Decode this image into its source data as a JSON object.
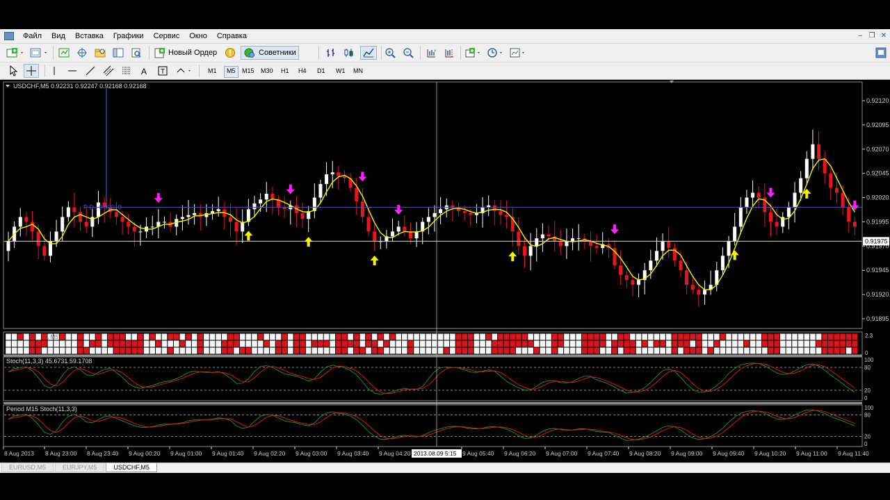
{
  "menu": [
    "Файл",
    "Вид",
    "Вставка",
    "Графики",
    "Сервис",
    "Окно",
    "Справка"
  ],
  "toolbar": {
    "new_order": "Новый Ордер",
    "advisors": "Советники"
  },
  "timeframes": [
    "M1",
    "M5",
    "M15",
    "M30",
    "H1",
    "H4",
    "D1",
    "W1",
    "MN"
  ],
  "active_timeframe": "M5",
  "chart": {
    "header": "USDCHF,M5  0.92231 0.92247 0.92168 0.92168",
    "pdo_label": "P D.. 0.92010",
    "current_price": "0.91975",
    "price_levels": [
      "0.92120",
      "0.92095",
      "0.92070",
      "0.92045",
      "0.92020",
      "0.91995",
      "0.91970",
      "0.91945",
      "0.91920",
      "0.91895"
    ],
    "crosshair_time": "2013.08.09 5:15"
  },
  "indicators": {
    "grid_label": "1 M5",
    "grid_scale": [
      "2.3",
      "0"
    ],
    "stoch1_label": "Stoch(11,3,3) 45.6731 59.1708",
    "stoch1_scale": [
      "100",
      "80",
      "20",
      "0"
    ],
    "stoch2_label": "Period M15 Stoch(11,3,3)",
    "stoch2_scale": [
      "100",
      "80",
      "20",
      "0"
    ]
  },
  "time_labels": [
    "8 Aug 2013",
    "8 Aug 23:00",
    "8 Aug 23:40",
    "9 Aug 00:20",
    "9 Aug 01:00",
    "9 Aug 01:40",
    "9 Aug 02:20",
    "9 Aug 03:00",
    "9 Aug 03:40",
    "9 Aug 04:20",
    "9 Aug 05:40",
    "9 Aug 06:20",
    "9 Aug 07:00",
    "9 Aug 07:40",
    "9 Aug 08:20",
    "9 Aug 09:00",
    "9 Aug 09:40",
    "9 Aug 10:20",
    "9 Aug 11:00",
    "9 Aug 11:40"
  ],
  "tabs": [
    "EURUSD,M5",
    "EURJPY,M5",
    "USDCHF,M5"
  ],
  "active_tab": "USDCHF,M5",
  "colors": {
    "bull": "#ffffff",
    "bear": "#e8141e",
    "ma": "#f5f500",
    "arrow_up": "#f5f500",
    "arrow_down": "#ff22ff",
    "stoch_main": "#1f8a1f",
    "stoch_signal": "#d41a1a"
  },
  "chart_data": {
    "type": "candlestick",
    "symbol": "USDCHF",
    "timeframe": "M5",
    "ylim": [
      0.91885,
      0.9213
    ],
    "close": [
      0.91975,
      0.9199,
      0.92,
      0.91995,
      0.91985,
      0.9197,
      0.9196,
      0.91975,
      0.91985,
      0.92,
      0.9201,
      0.92005,
      0.91995,
      0.9199,
      0.92,
      0.92015,
      0.9201,
      0.92005,
      0.92,
      0.91995,
      0.9199,
      0.91985,
      0.91985,
      0.9199,
      0.9199,
      0.91995,
      0.91995,
      0.9199,
      0.91998,
      0.92,
      0.92002,
      0.92004,
      0.92,
      0.92004,
      0.92006,
      0.92008,
      0.92,
      0.91995,
      0.91985,
      0.91995,
      0.92008,
      0.92014,
      0.92018,
      0.92024,
      0.92018,
      0.9201,
      0.92008,
      0.92012,
      0.92004,
      0.91998,
      0.92006,
      0.9202,
      0.92034,
      0.92044,
      0.92046,
      0.92042,
      0.9204,
      0.9203,
      0.92016,
      0.92,
      0.91985,
      0.91975,
      0.91975,
      0.9198,
      0.91985,
      0.9199,
      0.91985,
      0.91978,
      0.91985,
      0.91995,
      0.92,
      0.92004,
      0.92008,
      0.92012,
      0.9201,
      0.92006,
      0.92004,
      0.92002,
      0.92004,
      0.9201,
      0.92012,
      0.92006,
      0.92002,
      0.92,
      0.91985,
      0.9197,
      0.9196,
      0.9197,
      0.91978,
      0.91982,
      0.9198,
      0.91975,
      0.9197,
      0.91975,
      0.91978,
      0.91978,
      0.91975,
      0.9197,
      0.91968,
      0.91972,
      0.91968,
      0.9195,
      0.9194,
      0.91935,
      0.9193,
      0.91935,
      0.91945,
      0.91955,
      0.91965,
      0.91975,
      0.91968,
      0.91955,
      0.91945,
      0.9193,
      0.91925,
      0.9192,
      0.91925,
      0.9193,
      0.91945,
      0.9196,
      0.91975,
      0.9199,
      0.9201,
      0.9202,
      0.92025,
      0.9202,
      0.92005,
      0.91995,
      0.9199,
      0.92,
      0.9201,
      0.92025,
      0.9204,
      0.9206,
      0.92075,
      0.9206,
      0.92045,
      0.9203,
      0.92025,
      0.9201,
      0.91995,
      0.9199
    ]
  }
}
